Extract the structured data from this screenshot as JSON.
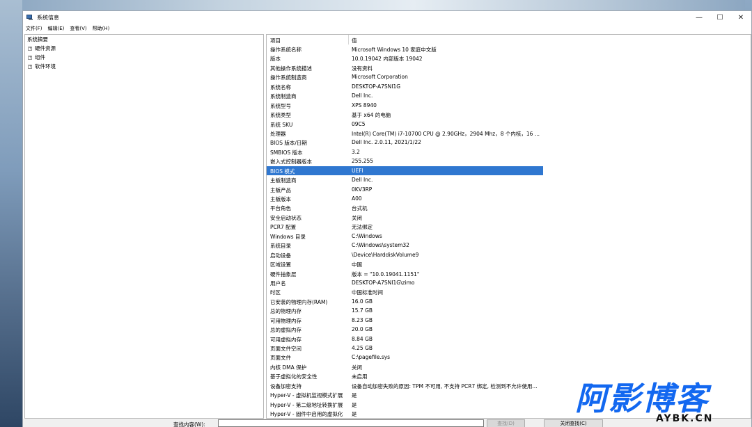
{
  "window": {
    "title": "系统信息",
    "controls": {
      "minimize": "—",
      "maximize": "☐",
      "close": "✕"
    }
  },
  "menu": [
    {
      "label": "文件(F)"
    },
    {
      "label": "编辑(E)"
    },
    {
      "label": "查看(V)"
    },
    {
      "label": "帮助(H)"
    }
  ],
  "tree": {
    "root": "系统摘要",
    "children": [
      {
        "label": "硬件资源"
      },
      {
        "label": "组件"
      },
      {
        "label": "软件环境"
      }
    ]
  },
  "table": {
    "headers": {
      "item": "项目",
      "value": "值"
    },
    "selected_index": 14,
    "rows": [
      {
        "item": "操作系统名称",
        "value": "Microsoft Windows 10 家庭中文版"
      },
      {
        "item": "版本",
        "value": "10.0.19042 内部版本 19042"
      },
      {
        "item": "其他操作系统描述",
        "value": "没有资料"
      },
      {
        "item": "操作系统制造商",
        "value": "Microsoft Corporation"
      },
      {
        "item": "系统名称",
        "value": "DESKTOP-A7SNI1G"
      },
      {
        "item": "系统制造商",
        "value": "Dell Inc."
      },
      {
        "item": "系统型号",
        "value": "XPS 8940"
      },
      {
        "item": "系统类型",
        "value": "基于 x64 的电脑"
      },
      {
        "item": "系统 SKU",
        "value": "09C5"
      },
      {
        "item": "处理器",
        "value": "Intel(R) Core(TM) i7-10700 CPU @ 2.90GHz，2904 Mhz，8 个内核，16 ..."
      },
      {
        "item": "BIOS 版本/日期",
        "value": "Dell Inc. 2.0.11, 2021/1/22"
      },
      {
        "item": "SMBIOS 版本",
        "value": "3.2"
      },
      {
        "item": "嵌入式控制器版本",
        "value": "255.255"
      },
      {
        "item": "BIOS 模式",
        "value": "UEFI"
      },
      {
        "item": "主板制造商",
        "value": "Dell Inc."
      },
      {
        "item": "主板产品",
        "value": "0KV3RP"
      },
      {
        "item": "主板版本",
        "value": "A00"
      },
      {
        "item": "平台角色",
        "value": "台式机"
      },
      {
        "item": "安全启动状态",
        "value": "关闭"
      },
      {
        "item": "PCR7 配置",
        "value": "无法绑定"
      },
      {
        "item": "Windows 目录",
        "value": "C:\\Windows"
      },
      {
        "item": "系统目录",
        "value": "C:\\Windows\\system32"
      },
      {
        "item": "启动设备",
        "value": "\\Device\\HarddiskVolume9"
      },
      {
        "item": "区域设置",
        "value": "中国"
      },
      {
        "item": "硬件抽象层",
        "value": "版本 = \"10.0.19041.1151\""
      },
      {
        "item": "用户名",
        "value": "DESKTOP-A7SNI1G\\zimo"
      },
      {
        "item": "时区",
        "value": "中国标准时间"
      },
      {
        "item": "已安装的物理内存(RAM)",
        "value": "16.0 GB"
      },
      {
        "item": "总的物理内存",
        "value": "15.7 GB"
      },
      {
        "item": "可用物理内存",
        "value": "8.23 GB"
      },
      {
        "item": "总的虚拟内存",
        "value": "20.0 GB"
      },
      {
        "item": "可用虚拟内存",
        "value": "8.84 GB"
      },
      {
        "item": "页面文件空间",
        "value": "4.25 GB"
      },
      {
        "item": "页面文件",
        "value": "C:\\pagefile.sys"
      },
      {
        "item": "内核 DMA 保护",
        "value": "关闭"
      },
      {
        "item": "基于虚拟化的安全性",
        "value": "未启用"
      },
      {
        "item": "设备加密支持",
        "value": "设备自动加密失败的原因: TPM 不可用, 不支持 PCR7 绑定, 检测到不允许使用..."
      },
      {
        "item": "Hyper-V - 虚拟机监视模式扩展",
        "value": "是"
      },
      {
        "item": "Hyper-V - 第二级地址转换扩展",
        "value": "是"
      },
      {
        "item": "Hyper-V - 固件中启用的虚拟化",
        "value": "是"
      }
    ]
  },
  "findbar": {
    "label": "查找内容(W):",
    "input_value": "",
    "find_button": "查找(D)",
    "close_find_button": "关闭查找(C)"
  },
  "watermark": {
    "main": "阿影博客",
    "sub": "AYBK.CN"
  },
  "colors": {
    "selection": "#2f77d0",
    "watermark": "#1368f0"
  }
}
